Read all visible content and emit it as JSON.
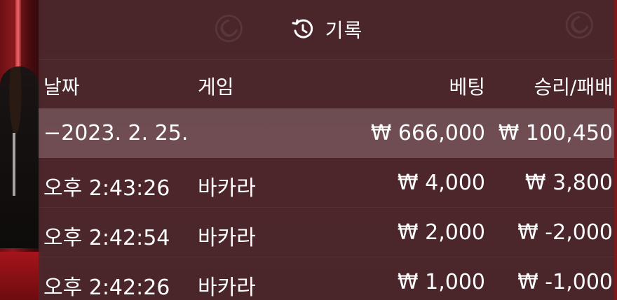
{
  "header": {
    "title": "기록",
    "icon": "history-icon"
  },
  "columns": {
    "date": "날짜",
    "game": "게임",
    "bet": "베팅",
    "result": "승리/패배"
  },
  "summary_row": {
    "date": "−2023. 2. 25.",
    "bet": "₩ 666,000",
    "result": "₩ 100,450"
  },
  "rows": [
    {
      "time": "오후 2:43:26",
      "game": "바카라",
      "bet": "₩ 4,000",
      "result": "₩ 3,800"
    },
    {
      "time": "오후 2:42:54",
      "game": "바카라",
      "bet": "₩ 2,000",
      "result": "₩ -2,000"
    },
    {
      "time": "오후 2:42:26",
      "game": "바카라",
      "bet": "₩ 1,000",
      "result": "₩ -1,000"
    }
  ],
  "colors": {
    "panel": "#4b282c",
    "highlight": "#8c6e72",
    "text": "#ffffff"
  }
}
